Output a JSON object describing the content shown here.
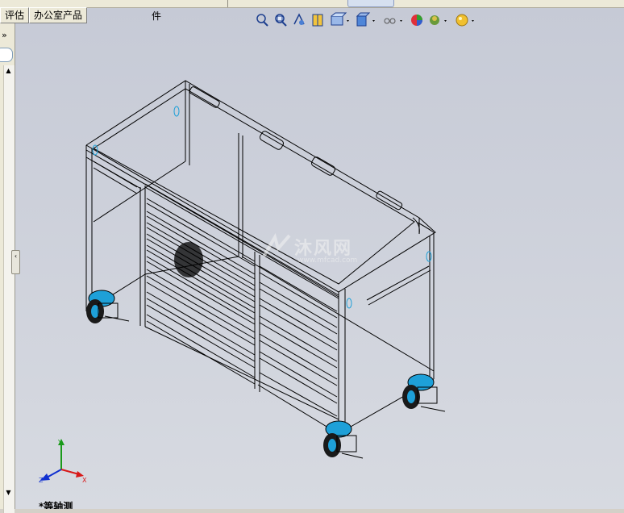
{
  "menu": {
    "fragment_label": "部件"
  },
  "tabs": [
    {
      "label": "评估"
    },
    {
      "label": "办公室产品"
    }
  ],
  "left_panel": {
    "collapse_glyph": "»"
  },
  "toolbar": {
    "icons": [
      "zoom-to-fit-icon",
      "zoom-to-area-icon",
      "previous-view-icon",
      "section-view-icon",
      "view-orientation-icon",
      "display-style-icon",
      "hide-show-items-icon",
      "edit-appearance-icon",
      "apply-scene-icon",
      "view-settings-icon"
    ]
  },
  "watermark": {
    "text": "沐风网",
    "sub": "www.mfcad.com"
  },
  "triad": {
    "x": "X",
    "y": "Y",
    "z": "Z"
  },
  "view": {
    "label": "*等轴测"
  },
  "colors": {
    "viewport_top": "#c6cad6",
    "viewport_bottom": "#d7dae1",
    "caster_blue": "#1ea0d8",
    "lines": "#000000"
  }
}
